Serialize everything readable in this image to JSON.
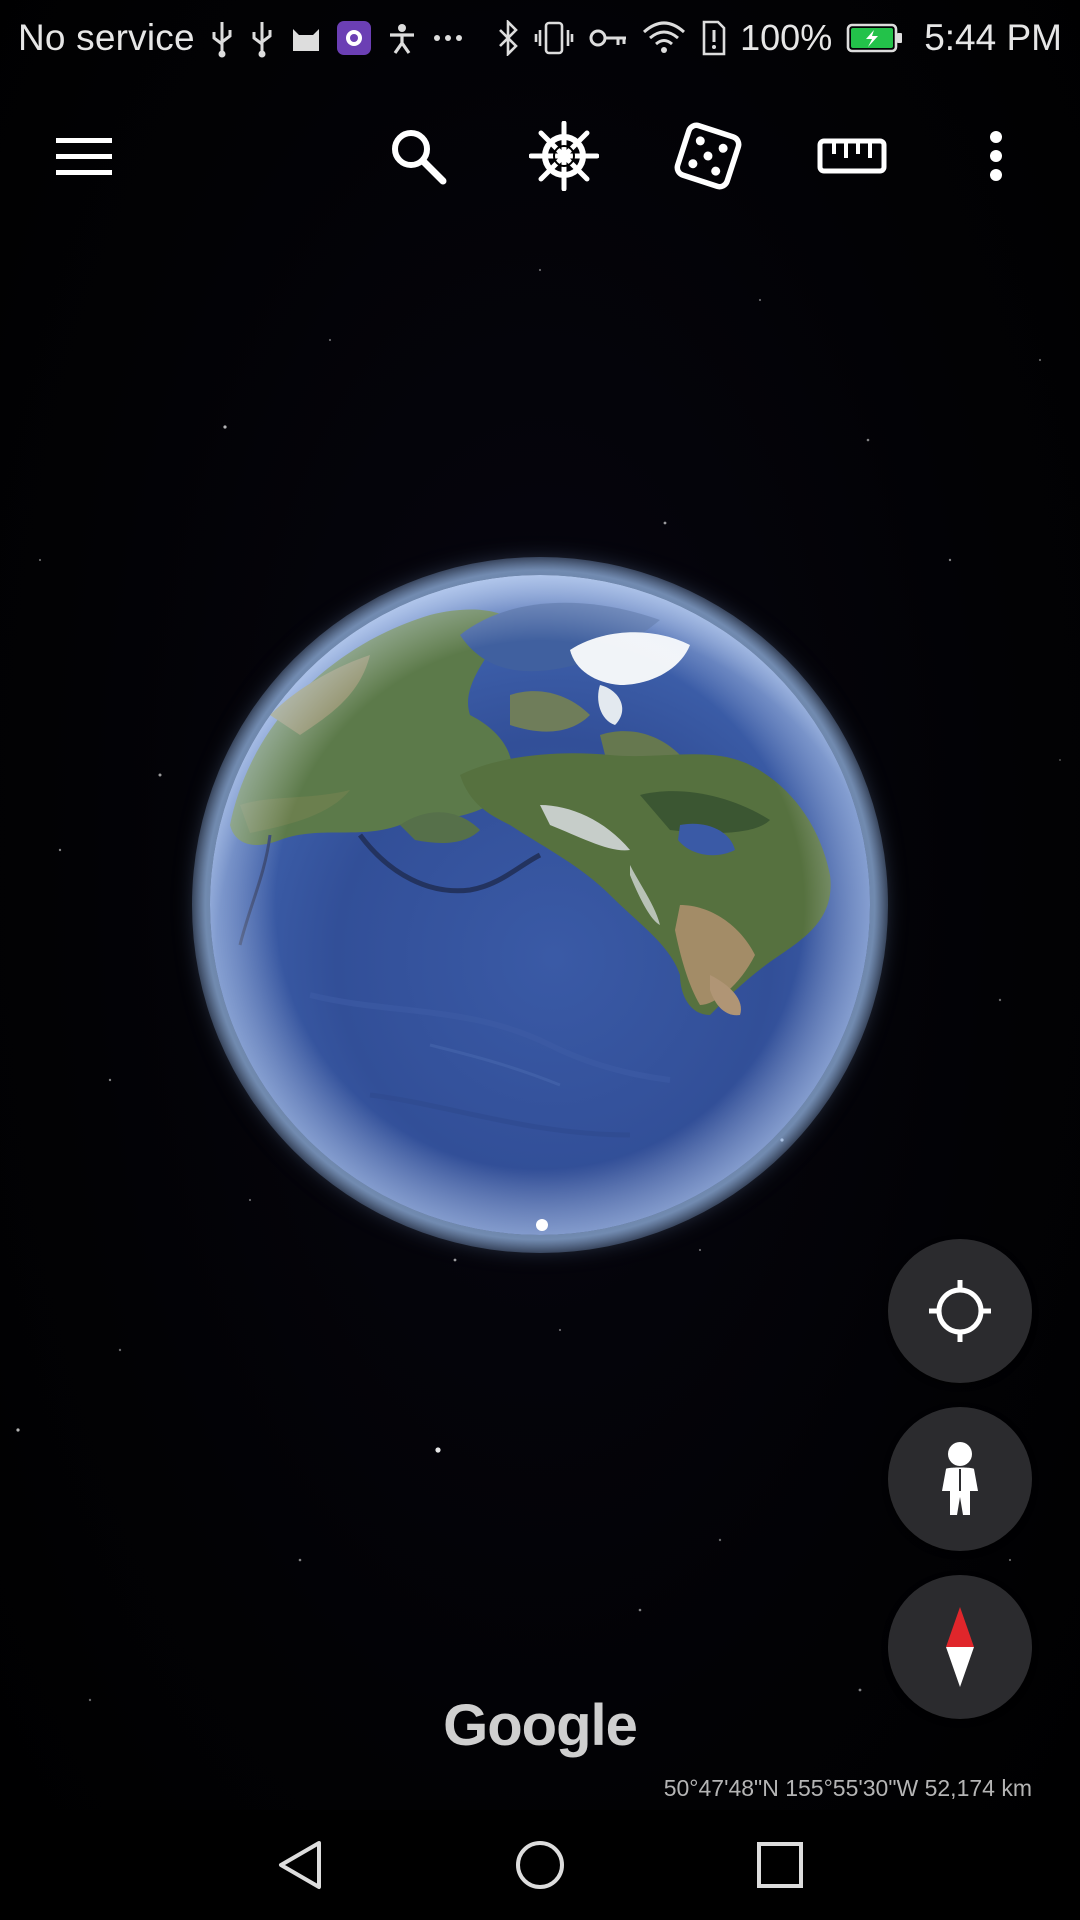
{
  "status_bar": {
    "carrier": "No service",
    "battery_percent": "100%",
    "time": "5:44 PM",
    "left_icons": [
      "usb-icon",
      "usb-icon",
      "cat-app-icon",
      "app-badge-icon",
      "accessibility-icon",
      "more-dots-icon"
    ],
    "right_icons": [
      "bluetooth-icon",
      "vibrate-icon",
      "vpn-key-icon",
      "wifi-icon",
      "storage-alert-icon",
      "battery-charging-icon"
    ],
    "battery_color": "#23c24a"
  },
  "toolbar": {
    "icons": [
      "menu-icon",
      "search-icon",
      "voyager-wheel-icon",
      "feeling-lucky-dice-icon",
      "measure-ruler-icon",
      "overflow-menu-icon"
    ]
  },
  "map": {
    "branding": "Google",
    "coordinates": "50°47'48\"N 155°55'30\"W 52,174 km"
  },
  "fabs": {
    "icons": [
      "my-location-icon",
      "pegman-icon",
      "compass-icon"
    ],
    "compass_north_color": "#e0262b"
  },
  "nav_bar": {
    "icons": [
      "back-icon",
      "home-icon",
      "recents-icon"
    ]
  }
}
